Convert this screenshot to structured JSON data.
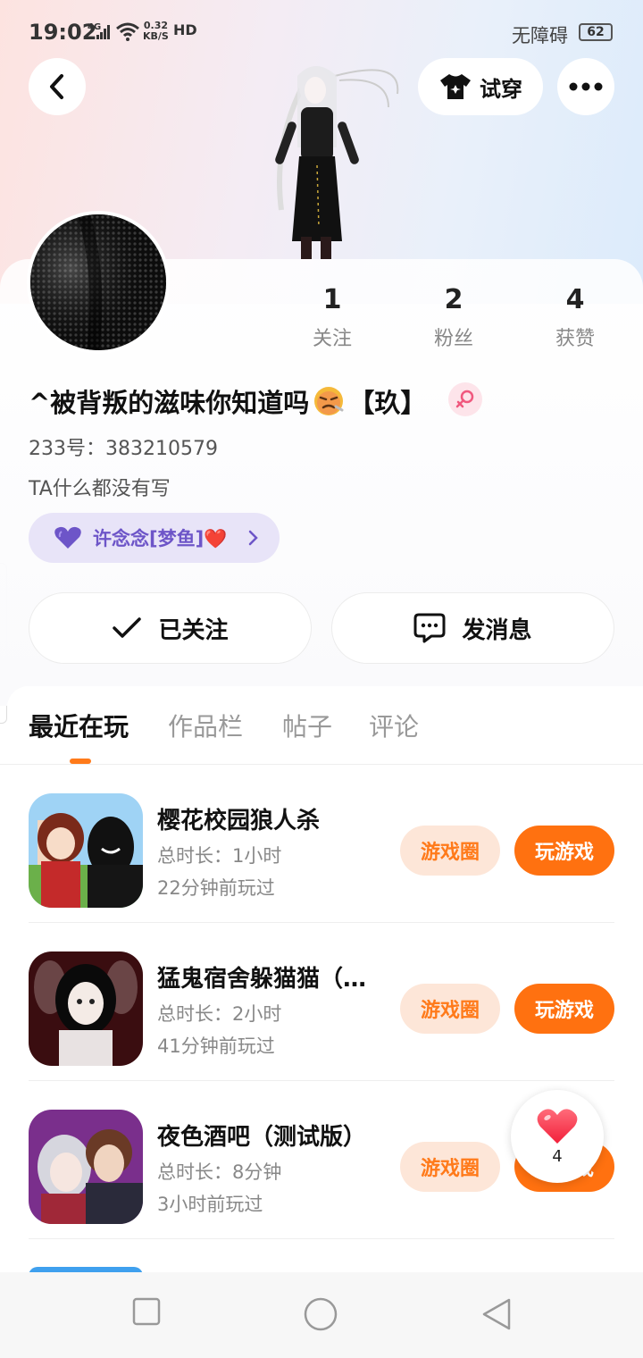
{
  "status_bar": {
    "time": "19:02",
    "network": "4G",
    "speed_value": "0.32",
    "speed_unit": "KB/S",
    "hd": "HD",
    "accessibility": "无障碍",
    "battery": "62"
  },
  "header": {
    "back_icon": "chevron-left-icon",
    "try_on_label": "试穿",
    "try_on_icon": "shirt-icon",
    "more_icon": "more-dots-icon"
  },
  "profile": {
    "stats": [
      {
        "value": "1",
        "label": "关注"
      },
      {
        "value": "2",
        "label": "粉丝"
      },
      {
        "value": "4",
        "label": "获赞"
      }
    ],
    "username": "^被背叛的滋味你知道吗",
    "username_suffix": "【玖】",
    "gender_icon": "female-icon",
    "uid": "233号：383210579",
    "bio": "TA什么都没有写",
    "tag": "许念念[梦鱼]❤️",
    "tag_icon": "purple-heart-icon"
  },
  "actions": {
    "followed_label": "已关注",
    "message_label": "发消息"
  },
  "tabs": [
    "最近在玩",
    "作品栏",
    "帖子",
    "评论"
  ],
  "games": [
    {
      "title": "樱花校园狼人杀",
      "duration": "总时长：1小时",
      "last_played": "22分钟前玩过",
      "circle_label": "游戏圈",
      "play_label": "玩游戏"
    },
    {
      "title": "猛鬼宿舍躲猫猫（…",
      "duration": "总时长：2小时",
      "last_played": "41分钟前玩过",
      "circle_label": "游戏圈",
      "play_label": "玩游戏"
    },
    {
      "title": "夜色酒吧（测试版）",
      "duration": "总时长：8分钟",
      "last_played": "3小时前玩过",
      "circle_label": "游戏圈",
      "play_label": "玩游戏"
    }
  ],
  "like_float": {
    "icon": "heart-icon",
    "count": "4"
  },
  "nav": {
    "recent_icon": "square-icon",
    "home_icon": "circle-icon",
    "back_icon": "triangle-back-icon"
  },
  "colors": {
    "accent": "#ff7110",
    "accent_light": "#fde6d8",
    "tag_bg": "#e8e4f8",
    "tag_text": "#6d55c8"
  }
}
